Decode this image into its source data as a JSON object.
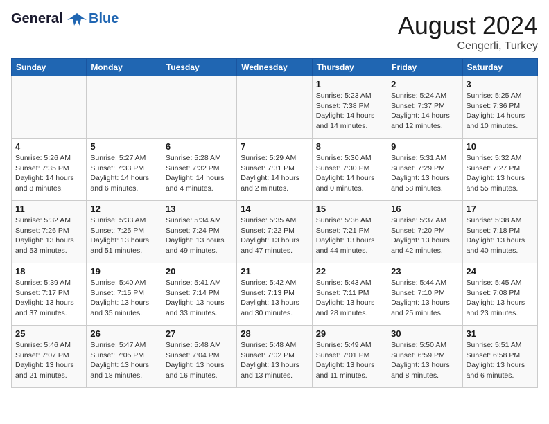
{
  "header": {
    "logo_line1": "General",
    "logo_line2": "Blue",
    "month_year": "August 2024",
    "location": "Cengerli, Turkey"
  },
  "days_of_week": [
    "Sunday",
    "Monday",
    "Tuesday",
    "Wednesday",
    "Thursday",
    "Friday",
    "Saturday"
  ],
  "weeks": [
    [
      {
        "day": "",
        "info": ""
      },
      {
        "day": "",
        "info": ""
      },
      {
        "day": "",
        "info": ""
      },
      {
        "day": "",
        "info": ""
      },
      {
        "day": "1",
        "info": "Sunrise: 5:23 AM\nSunset: 7:38 PM\nDaylight: 14 hours and 14 minutes."
      },
      {
        "day": "2",
        "info": "Sunrise: 5:24 AM\nSunset: 7:37 PM\nDaylight: 14 hours and 12 minutes."
      },
      {
        "day": "3",
        "info": "Sunrise: 5:25 AM\nSunset: 7:36 PM\nDaylight: 14 hours and 10 minutes."
      }
    ],
    [
      {
        "day": "4",
        "info": "Sunrise: 5:26 AM\nSunset: 7:35 PM\nDaylight: 14 hours and 8 minutes."
      },
      {
        "day": "5",
        "info": "Sunrise: 5:27 AM\nSunset: 7:33 PM\nDaylight: 14 hours and 6 minutes."
      },
      {
        "day": "6",
        "info": "Sunrise: 5:28 AM\nSunset: 7:32 PM\nDaylight: 14 hours and 4 minutes."
      },
      {
        "day": "7",
        "info": "Sunrise: 5:29 AM\nSunset: 7:31 PM\nDaylight: 14 hours and 2 minutes."
      },
      {
        "day": "8",
        "info": "Sunrise: 5:30 AM\nSunset: 7:30 PM\nDaylight: 14 hours and 0 minutes."
      },
      {
        "day": "9",
        "info": "Sunrise: 5:31 AM\nSunset: 7:29 PM\nDaylight: 13 hours and 58 minutes."
      },
      {
        "day": "10",
        "info": "Sunrise: 5:32 AM\nSunset: 7:27 PM\nDaylight: 13 hours and 55 minutes."
      }
    ],
    [
      {
        "day": "11",
        "info": "Sunrise: 5:32 AM\nSunset: 7:26 PM\nDaylight: 13 hours and 53 minutes."
      },
      {
        "day": "12",
        "info": "Sunrise: 5:33 AM\nSunset: 7:25 PM\nDaylight: 13 hours and 51 minutes."
      },
      {
        "day": "13",
        "info": "Sunrise: 5:34 AM\nSunset: 7:24 PM\nDaylight: 13 hours and 49 minutes."
      },
      {
        "day": "14",
        "info": "Sunrise: 5:35 AM\nSunset: 7:22 PM\nDaylight: 13 hours and 47 minutes."
      },
      {
        "day": "15",
        "info": "Sunrise: 5:36 AM\nSunset: 7:21 PM\nDaylight: 13 hours and 44 minutes."
      },
      {
        "day": "16",
        "info": "Sunrise: 5:37 AM\nSunset: 7:20 PM\nDaylight: 13 hours and 42 minutes."
      },
      {
        "day": "17",
        "info": "Sunrise: 5:38 AM\nSunset: 7:18 PM\nDaylight: 13 hours and 40 minutes."
      }
    ],
    [
      {
        "day": "18",
        "info": "Sunrise: 5:39 AM\nSunset: 7:17 PM\nDaylight: 13 hours and 37 minutes."
      },
      {
        "day": "19",
        "info": "Sunrise: 5:40 AM\nSunset: 7:15 PM\nDaylight: 13 hours and 35 minutes."
      },
      {
        "day": "20",
        "info": "Sunrise: 5:41 AM\nSunset: 7:14 PM\nDaylight: 13 hours and 33 minutes."
      },
      {
        "day": "21",
        "info": "Sunrise: 5:42 AM\nSunset: 7:13 PM\nDaylight: 13 hours and 30 minutes."
      },
      {
        "day": "22",
        "info": "Sunrise: 5:43 AM\nSunset: 7:11 PM\nDaylight: 13 hours and 28 minutes."
      },
      {
        "day": "23",
        "info": "Sunrise: 5:44 AM\nSunset: 7:10 PM\nDaylight: 13 hours and 25 minutes."
      },
      {
        "day": "24",
        "info": "Sunrise: 5:45 AM\nSunset: 7:08 PM\nDaylight: 13 hours and 23 minutes."
      }
    ],
    [
      {
        "day": "25",
        "info": "Sunrise: 5:46 AM\nSunset: 7:07 PM\nDaylight: 13 hours and 21 minutes."
      },
      {
        "day": "26",
        "info": "Sunrise: 5:47 AM\nSunset: 7:05 PM\nDaylight: 13 hours and 18 minutes."
      },
      {
        "day": "27",
        "info": "Sunrise: 5:48 AM\nSunset: 7:04 PM\nDaylight: 13 hours and 16 minutes."
      },
      {
        "day": "28",
        "info": "Sunrise: 5:48 AM\nSunset: 7:02 PM\nDaylight: 13 hours and 13 minutes."
      },
      {
        "day": "29",
        "info": "Sunrise: 5:49 AM\nSunset: 7:01 PM\nDaylight: 13 hours and 11 minutes."
      },
      {
        "day": "30",
        "info": "Sunrise: 5:50 AM\nSunset: 6:59 PM\nDaylight: 13 hours and 8 minutes."
      },
      {
        "day": "31",
        "info": "Sunrise: 5:51 AM\nSunset: 6:58 PM\nDaylight: 13 hours and 6 minutes."
      }
    ]
  ]
}
